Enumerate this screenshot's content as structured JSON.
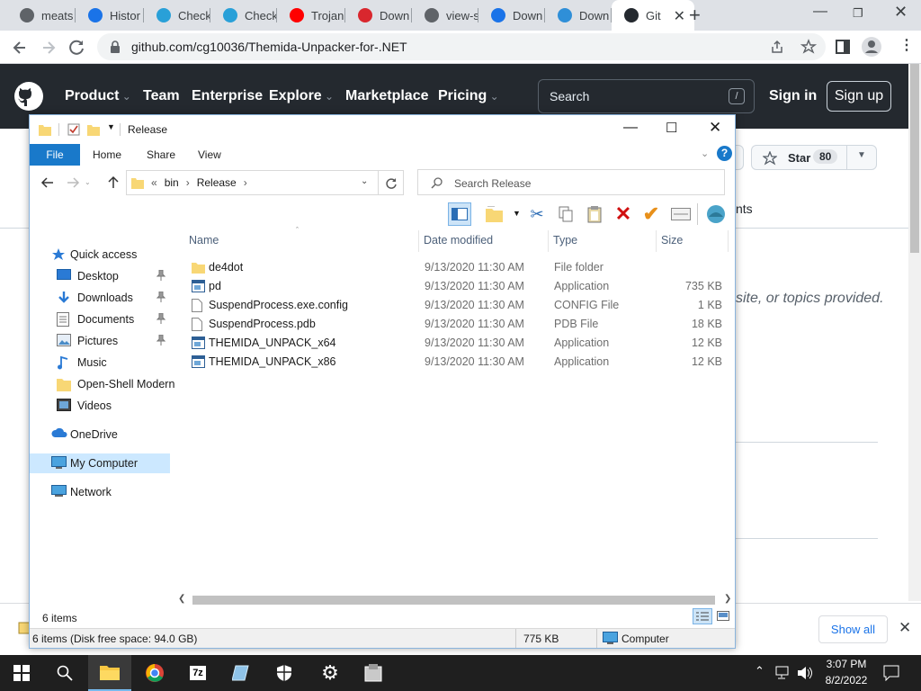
{
  "browser": {
    "tabs": [
      {
        "label": "meats",
        "icon": "tab-site-icon",
        "color": "#5f6368"
      },
      {
        "label": "Histor",
        "icon": "history-icon",
        "color": "#1a73e8"
      },
      {
        "label": "Check",
        "icon": "check-site-icon",
        "color": "#29a0d8"
      },
      {
        "label": "Check",
        "icon": "check-site-icon",
        "color": "#29a0d8"
      },
      {
        "label": "Trojan",
        "icon": "youtube-icon",
        "color": "#ff0000"
      },
      {
        "label": "Down",
        "icon": "mega-icon",
        "color": "#d9272e"
      },
      {
        "label": "view-s",
        "icon": "chrome-icon",
        "color": "#5f6368"
      },
      {
        "label": "Down",
        "icon": "download-icon",
        "color": "#1a73e8"
      },
      {
        "label": "Down",
        "icon": "edge-icon",
        "color": "#2f8fd8"
      },
      {
        "label": "Git",
        "icon": "github-icon",
        "color": "#24292f"
      }
    ],
    "url": "github.com/cg10036/Themida-Unpacker-for-.NET"
  },
  "github": {
    "nav": [
      "Product",
      "Team",
      "Enterprise",
      "Explore",
      "Marketplace",
      "Pricing"
    ],
    "search_placeholder": "Search",
    "slash": "/",
    "sign_in": "Sign in",
    "sign_up": "Sign up",
    "star_label": "Star",
    "star_count": "80",
    "partial_tab": "nts",
    "about_text": "site, or topics provided."
  },
  "explorer": {
    "title": "Release",
    "ribbon_tabs": {
      "file": "File",
      "home": "Home",
      "share": "Share",
      "view": "View"
    },
    "breadcrumb": {
      "prefix": "«",
      "parts": [
        "bin",
        "Release"
      ]
    },
    "search_placeholder": "Search Release",
    "nav": [
      {
        "label": "Quick access",
        "icon": "star-icon",
        "pinned": false
      },
      {
        "label": "Desktop",
        "icon": "desktop-icon",
        "pinned": true
      },
      {
        "label": "Downloads",
        "icon": "download-arrow-icon",
        "pinned": true
      },
      {
        "label": "Documents",
        "icon": "documents-icon",
        "pinned": true
      },
      {
        "label": "Pictures",
        "icon": "pictures-icon",
        "pinned": true
      },
      {
        "label": "Music",
        "icon": "music-icon",
        "pinned": false
      },
      {
        "label": "Open-Shell Modern",
        "icon": "folder-icon",
        "pinned": false
      },
      {
        "label": "Videos",
        "icon": "videos-icon",
        "pinned": false
      },
      {
        "label": "OneDrive",
        "icon": "cloud-icon",
        "pinned": false
      },
      {
        "label": "My Computer",
        "icon": "computer-icon",
        "pinned": false,
        "selected": true
      },
      {
        "label": "Network",
        "icon": "network-icon",
        "pinned": false
      }
    ],
    "columns": {
      "name": "Name",
      "date": "Date modified",
      "type": "Type",
      "size": "Size"
    },
    "files": [
      {
        "name": "de4dot",
        "date": "9/13/2020 11:30 AM",
        "type": "File folder",
        "size": "",
        "icon": "folder-icon"
      },
      {
        "name": "pd",
        "date": "9/13/2020 11:30 AM",
        "type": "Application",
        "size": "735 KB",
        "icon": "app-icon"
      },
      {
        "name": "SuspendProcess.exe.config",
        "date": "9/13/2020 11:30 AM",
        "type": "CONFIG File",
        "size": "1 KB",
        "icon": "file-icon"
      },
      {
        "name": "SuspendProcess.pdb",
        "date": "9/13/2020 11:30 AM",
        "type": "PDB File",
        "size": "18 KB",
        "icon": "file-icon"
      },
      {
        "name": "THEMIDA_UNPACK_x64",
        "date": "9/13/2020 11:30 AM",
        "type": "Application",
        "size": "12 KB",
        "icon": "app-icon"
      },
      {
        "name": "THEMIDA_UNPACK_x86",
        "date": "9/13/2020 11:30 AM",
        "type": "Application",
        "size": "12 KB",
        "icon": "app-icon"
      }
    ],
    "item_count": "6 items",
    "status_left": "6 items (Disk free space: 94.0 GB)",
    "status_size": "775 KB",
    "status_location": "Computer"
  },
  "shelf": {
    "show_all": "Show all"
  },
  "taskbar": {
    "time": "3:07 PM",
    "date": "8/2/2022"
  }
}
